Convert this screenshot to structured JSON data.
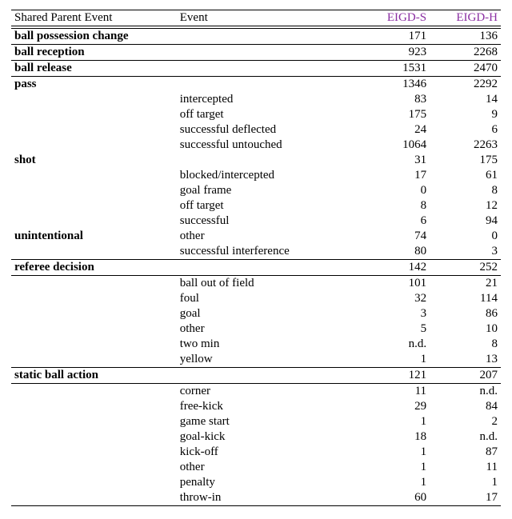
{
  "chart_data": {
    "type": "table",
    "columns": [
      "Shared Parent Event",
      "Event",
      "EIGD-S",
      "EIGD-H"
    ],
    "header_color": "#8b2fa3",
    "rows": [
      {
        "section": true,
        "parent": "ball possession change",
        "event": "",
        "s": "171",
        "h": "136"
      },
      {
        "section": true,
        "parent": "ball reception",
        "event": "",
        "s": "923",
        "h": "2268"
      },
      {
        "section": true,
        "parent": "ball release",
        "event": "",
        "s": "1531",
        "h": "2470"
      },
      {
        "section": true,
        "parent": "pass",
        "event": "",
        "s": "1346",
        "h": "2292"
      },
      {
        "parent": "",
        "event": "intercepted",
        "s": "83",
        "h": "14"
      },
      {
        "parent": "",
        "event": "off target",
        "s": "175",
        "h": "9"
      },
      {
        "parent": "",
        "event": "successful deflected",
        "s": "24",
        "h": "6"
      },
      {
        "parent": "",
        "event": "successful untouched",
        "s": "1064",
        "h": "2263"
      },
      {
        "parent": "shot",
        "event": "",
        "s": "31",
        "h": "175"
      },
      {
        "parent": "",
        "event": "blocked/intercepted",
        "s": "17",
        "h": "61"
      },
      {
        "parent": "",
        "event": "goal frame",
        "s": "0",
        "h": "8"
      },
      {
        "parent": "",
        "event": "off target",
        "s": "8",
        "h": "12"
      },
      {
        "parent": "",
        "event": "successful",
        "s": "6",
        "h": "94"
      },
      {
        "parent": "unintentional",
        "event": "other",
        "s": "74",
        "h": "0"
      },
      {
        "parent": "",
        "event": "successful interference",
        "s": "80",
        "h": "3"
      },
      {
        "section": true,
        "parent": "referee decision",
        "event": "",
        "s": "142",
        "h": "252"
      },
      {
        "section": true,
        "parent": "",
        "event": "ball out of field",
        "s": "101",
        "h": "21"
      },
      {
        "parent": "",
        "event": "foul",
        "s": "32",
        "h": "114"
      },
      {
        "parent": "",
        "event": "goal",
        "s": "3",
        "h": "86"
      },
      {
        "parent": "",
        "event": "other",
        "s": "5",
        "h": "10"
      },
      {
        "parent": "",
        "event": "two min",
        "s": "n.d.",
        "h": "8"
      },
      {
        "parent": "",
        "event": "yellow",
        "s": "1",
        "h": "13"
      },
      {
        "section": true,
        "parent": "static ball action",
        "event": "",
        "s": "121",
        "h": "207"
      },
      {
        "section": true,
        "parent": "",
        "event": "corner",
        "s": "11",
        "h": "n.d."
      },
      {
        "parent": "",
        "event": "free-kick",
        "s": "29",
        "h": "84"
      },
      {
        "parent": "",
        "event": "game start",
        "s": "1",
        "h": "2"
      },
      {
        "parent": "",
        "event": "goal-kick",
        "s": "18",
        "h": "n.d."
      },
      {
        "parent": "",
        "event": "kick-off",
        "s": "1",
        "h": "87"
      },
      {
        "parent": "",
        "event": "other",
        "s": "1",
        "h": "11"
      },
      {
        "parent": "",
        "event": "penalty",
        "s": "1",
        "h": "1"
      },
      {
        "parent": "",
        "event": "throw-in",
        "s": "60",
        "h": "17",
        "bottom": true
      }
    ]
  }
}
